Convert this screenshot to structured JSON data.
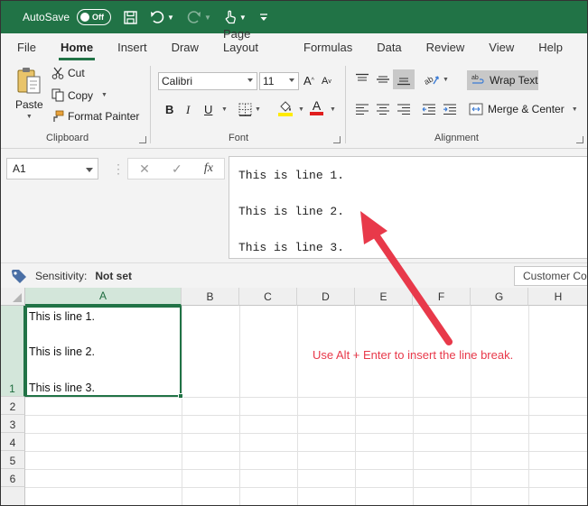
{
  "titlebar": {
    "autosave_label": "AutoSave",
    "autosave_state": "Off"
  },
  "tabs": [
    {
      "label": "File"
    },
    {
      "label": "Home",
      "active": true
    },
    {
      "label": "Insert"
    },
    {
      "label": "Draw"
    },
    {
      "label": "Page Layout"
    },
    {
      "label": "Formulas"
    },
    {
      "label": "Data"
    },
    {
      "label": "Review"
    },
    {
      "label": "View"
    },
    {
      "label": "Help"
    }
  ],
  "ribbon": {
    "clipboard": {
      "paste": "Paste",
      "cut": "Cut",
      "copy": "Copy",
      "format_painter": "Format Painter",
      "label": "Clipboard"
    },
    "font": {
      "name": "Calibri",
      "size": "11",
      "bold": "B",
      "italic": "I",
      "underline": "U",
      "label": "Font",
      "highlight_color": "#ffeb00",
      "font_color": "#e01e1e"
    },
    "alignment": {
      "wrap_text": "Wrap Text",
      "merge_center": "Merge & Center",
      "label": "Alignment"
    }
  },
  "formula": {
    "name_box": "A1",
    "fx": "fx",
    "lines": [
      "This is line 1.",
      "This is line 2.",
      "This is line 3."
    ]
  },
  "sensitivity": {
    "label": "Sensitivity:",
    "value": "Not set",
    "customer": "Customer Co"
  },
  "grid": {
    "columns": [
      "A",
      "B",
      "C",
      "D",
      "E",
      "F",
      "G",
      "H"
    ],
    "rows": [
      "1",
      "2",
      "3",
      "4",
      "5",
      "6"
    ],
    "a1_lines": [
      "This is line 1.",
      "This is line 2.",
      "This is line 3."
    ]
  },
  "annotation": {
    "text": "Use Alt + Enter to insert the line break.",
    "color": "#e8394a"
  },
  "colors": {
    "brand": "#217346",
    "ribbon_bg": "#f3f3f3"
  }
}
